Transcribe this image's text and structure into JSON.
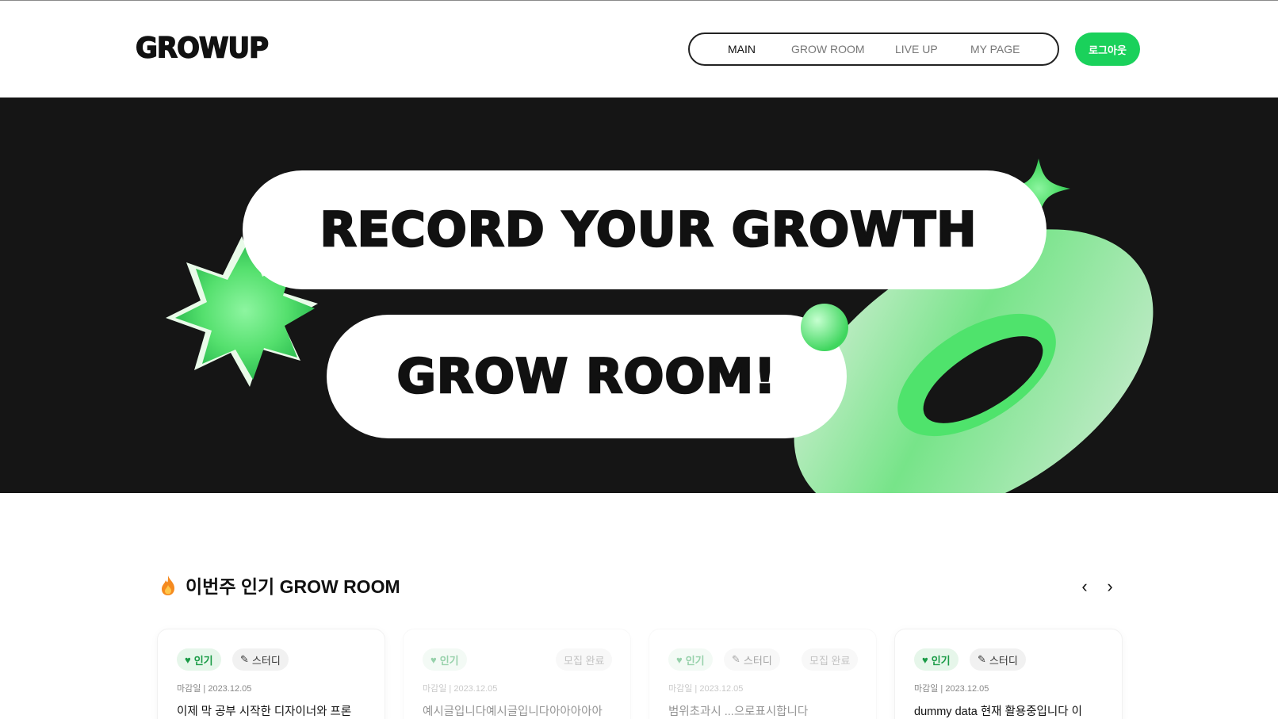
{
  "header": {
    "logo": "GROWUP",
    "nav": [
      "MAIN",
      "GROW ROOM",
      "LIVE UP",
      "MY PAGE"
    ],
    "active_nav": "MAIN",
    "logout_label": "로그아웃",
    "accent_color": "#1ad15b"
  },
  "banner": {
    "line1": "RECORD YOUR GROWTH",
    "line2": "GROW ROOM!",
    "background_color": "#151515",
    "shape_color": "#5ee77a"
  },
  "popular": {
    "icon": "fire-icon",
    "title": "이번주 인기 GROW ROOM",
    "prev_icon": "chevron-left-icon",
    "next_icon": "chevron-right-icon",
    "cards": [
      {
        "tags": [
          {
            "label": "인기",
            "icon": "heart-icon"
          },
          {
            "label": "스터디",
            "icon": "pencil-icon"
          }
        ],
        "status": "",
        "deadline": "마감일 | 2023.12.05",
        "title": "이제 막 공부 시작한 디자이너와 프론",
        "faded": false
      },
      {
        "tags": [
          {
            "label": "인기",
            "icon": "heart-icon"
          }
        ],
        "status": "모집 완료",
        "deadline": "마감일 | 2023.12.05",
        "title": "예시글입니다예시글입니다아아아아아",
        "faded": true
      },
      {
        "tags": [
          {
            "label": "인기",
            "icon": "heart-icon"
          },
          {
            "label": "스터디",
            "icon": "pencil-icon"
          }
        ],
        "status": "모집 완료",
        "deadline": "마감일 | 2023.12.05",
        "title": "범위초과시 ...으로표시합니다",
        "faded": true
      },
      {
        "tags": [
          {
            "label": "인기",
            "icon": "heart-icon"
          },
          {
            "label": "스터디",
            "icon": "pencil-icon"
          }
        ],
        "status": "",
        "deadline": "마감일 | 2023.12.05",
        "title": "dummy data 현재 활용중입니다 이",
        "faded": false
      }
    ]
  }
}
